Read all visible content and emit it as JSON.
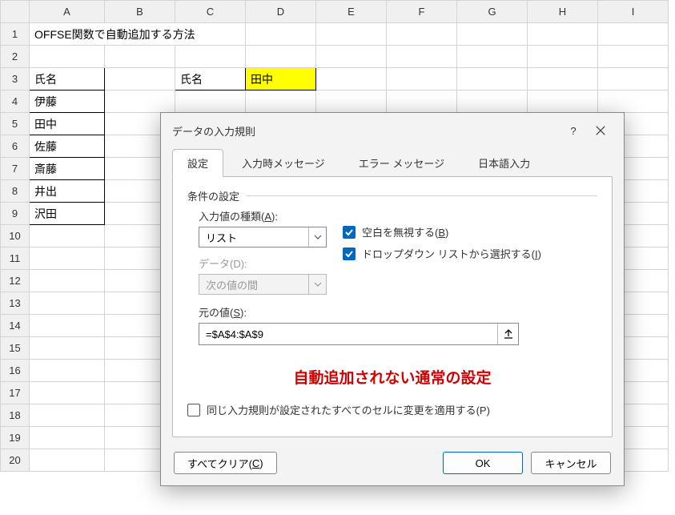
{
  "grid": {
    "columns": [
      "A",
      "B",
      "C",
      "D",
      "E",
      "F",
      "G",
      "H",
      "I"
    ],
    "row_count": 20,
    "cells": {
      "A1": "OFFSE関数で自動追加する方法",
      "A3": "氏名",
      "C3": "氏名",
      "D3": "田中",
      "A4": "伊藤",
      "A5": "田中",
      "A6": "佐藤",
      "A7": "斎藤",
      "A8": "井出",
      "A9": "沢田"
    }
  },
  "dialog": {
    "title": "データの入力規則",
    "help": "?",
    "tabs": {
      "t1": "設定",
      "t2": "入力時メッセージ",
      "t3": "エラー メッセージ",
      "t4": "日本語入力"
    },
    "section": "条件の設定",
    "allow_label": "入力値の種類(",
    "allow_key": "A",
    "allow_value": "リスト",
    "data_label": "データ(D):",
    "data_value": "次の値の間",
    "ignore_blank": "空白を無視する(",
    "ignore_blank_key": "B",
    "dropdown": "ドロップダウン リストから選択する(",
    "dropdown_key": "I",
    "source_label": "元の値(",
    "source_key": "S",
    "source_value": "=$A$4:$A$9",
    "red_note": "自動追加されない通常の設定",
    "apply_all": "同じ入力規則が設定されたすべてのセルに変更を適用する(P)",
    "clear_all": "すべてクリア(",
    "clear_all_key": "C",
    "ok": "OK",
    "cancel": "キャンセル"
  }
}
